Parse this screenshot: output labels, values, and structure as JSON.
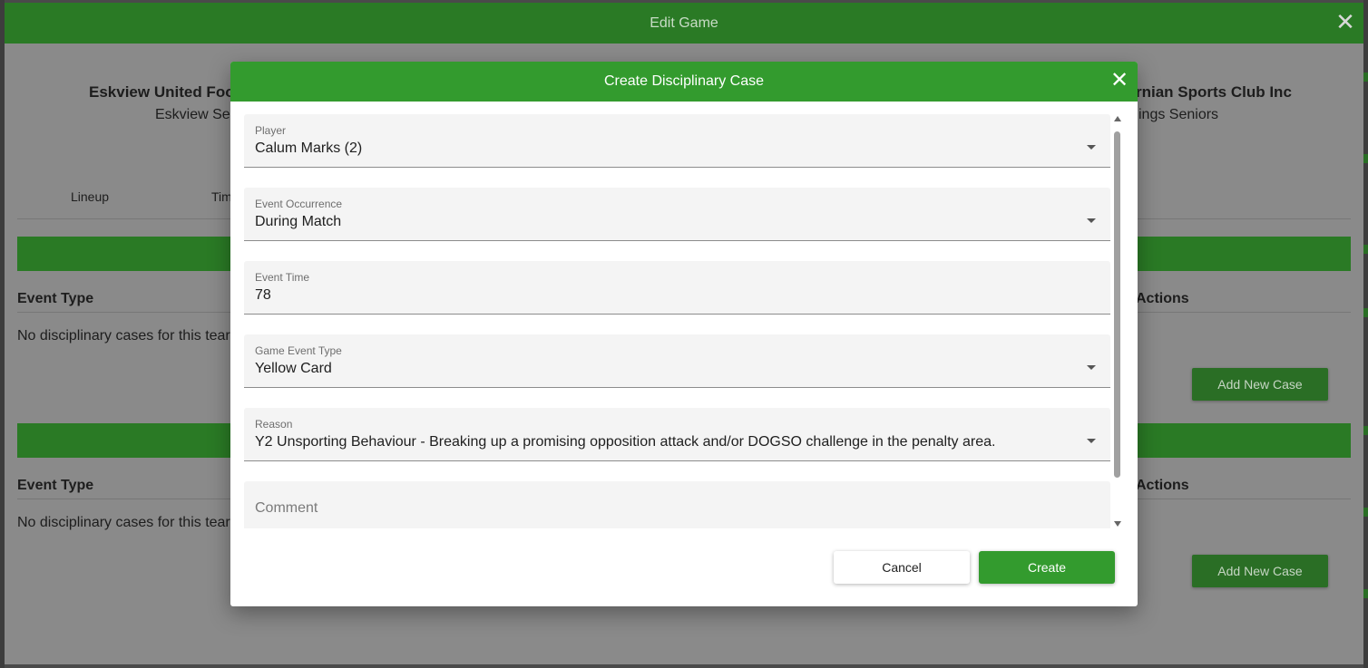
{
  "outer_dialog": {
    "title": "Edit Game",
    "home_team": {
      "name": "Eskview United Foo",
      "subtitle": "Eskview Sen"
    },
    "away_team": {
      "name": "rnian Sports Club Inc",
      "subtitle": "ings Seniors"
    },
    "tabs": [
      "Lineup",
      "Tim"
    ],
    "sections": [
      {
        "column_left": "Event Type",
        "column_right": "Actions",
        "empty_text": "No disciplinary cases for this tear",
        "add_button": "Add New Case"
      },
      {
        "column_left": "Event Type",
        "column_right": "Actions",
        "empty_text": "No disciplinary cases for this tear",
        "add_button": "Add New Case"
      }
    ]
  },
  "modal": {
    "title": "Create Disciplinary Case",
    "fields": {
      "player": {
        "label": "Player",
        "value": "Calum Marks (2)"
      },
      "event_occurrence": {
        "label": "Event Occurrence",
        "value": "During Match"
      },
      "event_time": {
        "label": "Event Time",
        "value": "78"
      },
      "game_event_type": {
        "label": "Game Event Type",
        "value": "Yellow Card"
      },
      "reason": {
        "label": "Reason",
        "value": "Y2 Unsporting Behaviour - Breaking up a promising opposition attack and/or DOGSO challenge in the penalty area."
      },
      "comment": {
        "placeholder": "Comment"
      }
    },
    "cancel_label": "Cancel",
    "create_label": "Create"
  },
  "icons": {
    "close": "close-icon",
    "dropdown": "chevron-down-icon"
  },
  "colors": {
    "header_green": "#339b2e",
    "outer_green": "#2a7a25"
  }
}
